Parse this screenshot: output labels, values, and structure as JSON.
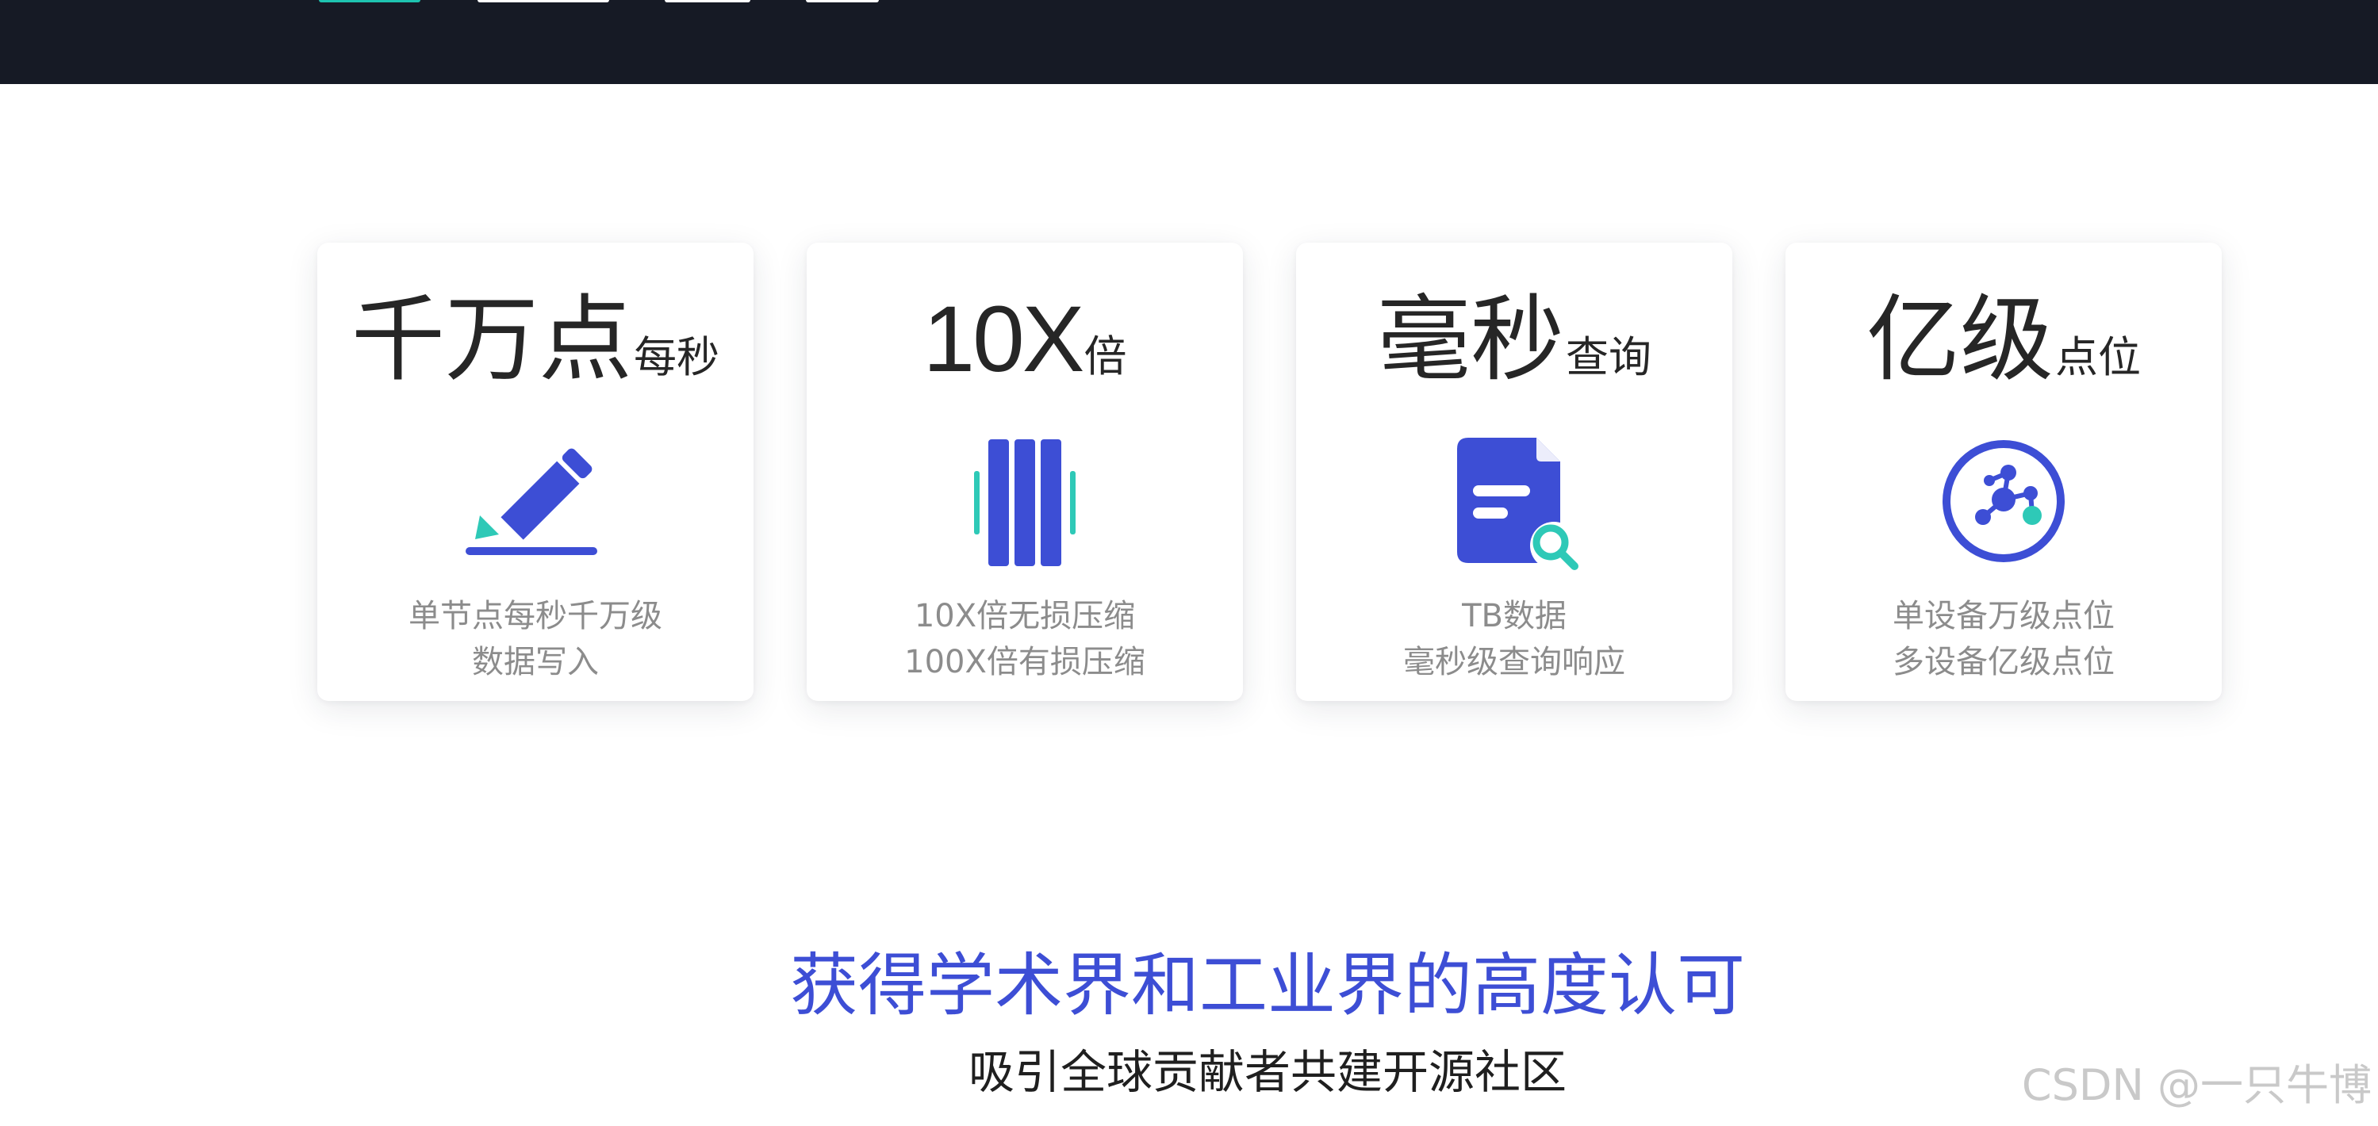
{
  "colors": {
    "nav_background": "#161a25",
    "nav_accent": "#1ec3b0",
    "icon_primary": "#3d4ed5",
    "icon_accent": "#2ec9b7",
    "headline_text": "#262626",
    "description_text": "#8c8c8c",
    "section_title": "#3d4ed5"
  },
  "features": [
    {
      "headline": "千万点",
      "headline_suffix": "每秒",
      "icon": "pencil-write-icon",
      "desc_line1": "单节点每秒千万级",
      "desc_line2": "数据写入"
    },
    {
      "headline": "10X",
      "headline_suffix": "倍",
      "icon": "compression-columns-icon",
      "desc_line1": "10X倍无损压缩",
      "desc_line2": "100X倍有损压缩"
    },
    {
      "headline": "毫秒",
      "headline_suffix": "查询",
      "icon": "document-search-icon",
      "desc_line1": "TB数据",
      "desc_line2": "毫秒级查询响应"
    },
    {
      "headline": "亿级",
      "headline_suffix": "点位",
      "icon": "network-nodes-icon",
      "desc_line1": "单设备万级点位",
      "desc_line2": "多设备亿级点位"
    }
  ],
  "recognition": {
    "title": "获得学术界和工业界的高度认可",
    "subtitle": "吸引全球贡献者共建开源社区"
  },
  "watermark": "CSDN @一只牛博"
}
